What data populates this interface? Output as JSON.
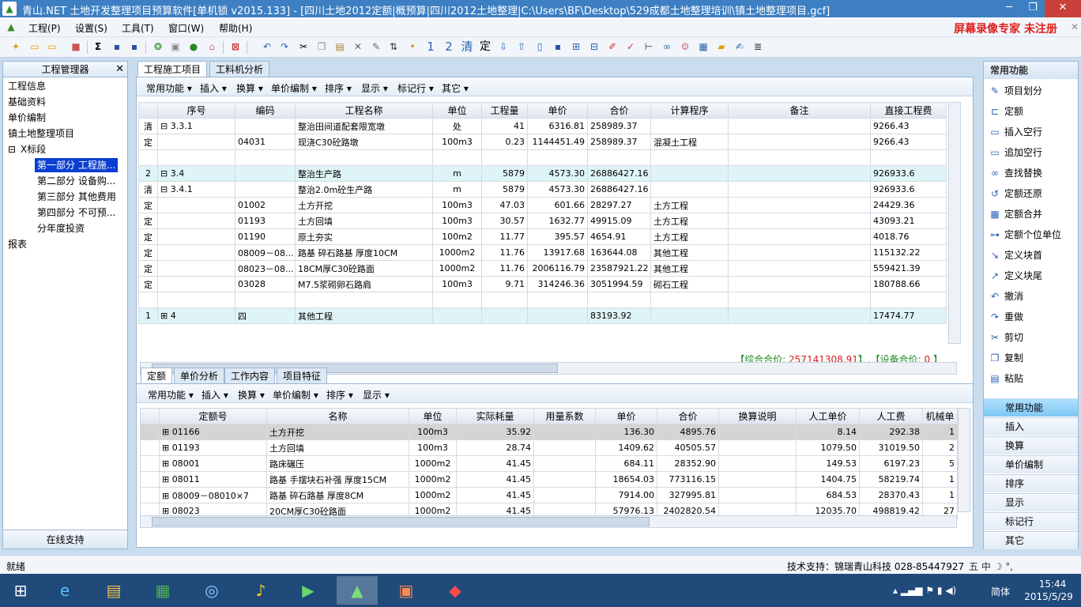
{
  "window": {
    "title": "青山.NET 土地开发整理项目预算软件[单机锁 v2015.133] - [四川土地2012定额|概预算|四川2012土地整理|C:\\Users\\BF\\Desktop\\529成都土地整理培训\\镇土地整理项目.gcf]",
    "min": "─",
    "max": "❐",
    "close": "✕"
  },
  "menu": [
    "工程(P)",
    "设置(S)",
    "工具(T)",
    "窗口(W)",
    "帮助(H)"
  ],
  "watermark": "屏幕录像专家  未注册",
  "toolbar": {
    "num1": "1",
    "num2": "2",
    "clear": "清",
    "fix": "定"
  },
  "left": {
    "title": "工程管理器",
    "close": "✕",
    "tree": [
      "工程信息",
      "基础资料",
      "单价编制",
      "镇土地整理项目",
      "X标段",
      "第一部分 工程施...",
      "第二部分 设备购...",
      "第三部分 其他费用",
      "第四部分 不可预...",
      "分年度投资",
      "报表"
    ],
    "footer": "在线支持"
  },
  "tabs": [
    "工程施工项目",
    "工料机分析"
  ],
  "upper_bar": [
    "常用功能 ▾",
    "插入 ▾",
    "换算 ▾",
    "单价编制 ▾",
    "排序 ▾",
    "显示 ▾",
    "标记行 ▾",
    "其它 ▾"
  ],
  "upper_cols": [
    "序号",
    "编码",
    "工程名称",
    "单位",
    "工程量",
    "单价",
    "合价",
    "计算程序",
    "备注",
    "直接工程费"
  ],
  "upper_rows": [
    [
      "清",
      "⊟ 3.3.1",
      "",
      "整治田间道配套限宽墩",
      "处",
      "41",
      "6316.81",
      "258989.37",
      "",
      "",
      "9266.43"
    ],
    [
      "定",
      "",
      "04031",
      "现浇C30砼路墩",
      "100m3",
      "0.23",
      "1144451.49",
      "258989.37",
      "混凝土工程",
      "",
      "9266.43"
    ],
    [
      "",
      "",
      "",
      "",
      "",
      "",
      "",
      "",
      "",
      "",
      ""
    ],
    [
      "2",
      "⊟ 3.4",
      "",
      "整治生产路",
      "m",
      "5879",
      "4573.30",
      "26886427.16",
      "",
      "",
      "926933.6"
    ],
    [
      "清",
      "⊟ 3.4.1",
      "",
      "整治2.0m砼生产路",
      "m",
      "5879",
      "4573.30",
      "26886427.16",
      "",
      "",
      "926933.6"
    ],
    [
      "定",
      "",
      "01002",
      "土方开挖",
      "100m3",
      "47.03",
      "601.66",
      "28297.27",
      "土方工程",
      "",
      "24429.36"
    ],
    [
      "定",
      "",
      "01193",
      "土方回填",
      "100m3",
      "30.57",
      "1632.77",
      "49915.09",
      "土方工程",
      "",
      "43093.21"
    ],
    [
      "定",
      "",
      "01190",
      "原土夯实",
      "100m2",
      "11.77",
      "395.57",
      "4654.91",
      "土方工程",
      "",
      "4018.76"
    ],
    [
      "定",
      "",
      "08009－08...",
      "路基 碎石路基 厚度10CM",
      "1000m2",
      "11.76",
      "13917.68",
      "163644.08",
      "其他工程",
      "",
      "115132.22"
    ],
    [
      "定",
      "",
      "08023－08...",
      "18CM厚C30砼路面",
      "1000m2",
      "11.76",
      "2006116.79",
      "23587921.22",
      "其他工程",
      "",
      "559421.39"
    ],
    [
      "定",
      "",
      "03028",
      "M7.5浆砌卵石路肩",
      "100m3",
      "9.71",
      "314246.36",
      "3051994.59",
      "砌石工程",
      "",
      "180788.66"
    ],
    [
      "",
      "",
      "",
      "",
      "",
      "",
      "",
      "",
      "",
      "",
      ""
    ],
    [
      "1",
      "⊞ 4",
      "四",
      "其他工程",
      "",
      "",
      "",
      "83193.92",
      "",
      "",
      "17474.77"
    ]
  ],
  "summary": {
    "p1": "【综合合价: ",
    "v1": "257141308.91",
    "p2": "】,【设备合价: ",
    "v2": "0",
    "p3": " 】"
  },
  "lower_tabs": [
    "定额",
    "单价分析",
    "工作内容",
    "项目特征"
  ],
  "lower_bar": [
    "常用功能 ▾",
    "插入 ▾",
    "换算 ▾",
    "单价编制 ▾",
    "排序 ▾",
    "显示 ▾"
  ],
  "lower_cols": [
    "定额号",
    "名称",
    "单位",
    "实际耗量",
    "用量系数",
    "单价",
    "合价",
    "换算说明",
    "人工单价",
    "人工费",
    "机械单"
  ],
  "lower_rows": [
    [
      "⊞ 01166",
      "土方开挖",
      "100m3",
      "35.92",
      "",
      "136.30",
      "4895.76",
      "",
      "8.14",
      "292.38",
      "1"
    ],
    [
      "⊞ 01193",
      "土方回填",
      "100m3",
      "28.74",
      "",
      "1409.62",
      "40505.57",
      "",
      "1079.50",
      "31019.50",
      "2"
    ],
    [
      "⊞ 08001",
      "路床碾压",
      "1000m2",
      "41.45",
      "",
      "684.11",
      "28352.90",
      "",
      "149.53",
      "6197.23",
      "5"
    ],
    [
      "⊞ 08011",
      "路基 手摆块石补强 厚度15CM",
      "1000m2",
      "41.45",
      "",
      "18654.03",
      "773116.15",
      "",
      "1404.75",
      "58219.74",
      "1"
    ],
    [
      "⊞ 08009－08010×7",
      "路基 碎石路基 厚度8CM",
      "1000m2",
      "41.45",
      "",
      "7914.00",
      "327995.81",
      "",
      "684.53",
      "28370.43",
      "1"
    ],
    [
      "⊞ 08023",
      "20CM厚C30砼路面",
      "1000m2",
      "41.45",
      "",
      "57976.13",
      "2402820.54",
      "",
      "12035.70",
      "498819.42",
      "27"
    ]
  ],
  "right": {
    "title": "常用功能",
    "items": [
      "项目划分",
      "定额",
      "插入空行",
      "追加空行",
      "查找替换",
      "定额还原",
      "定额合并",
      "定额个位单位",
      "定义块首",
      "定义块尾",
      "撤消",
      "重做",
      "剪切",
      "复制",
      "粘贴"
    ],
    "tabs": [
      "常用功能",
      "插入",
      "换算",
      "单价编制",
      "排序",
      "显示",
      "标记行",
      "其它"
    ]
  },
  "status": {
    "left": "就绪",
    "support": "技术支持：锦瑞青山科技 028-85447927",
    "ime": "五 中 ☽ °,"
  },
  "clock": {
    "time": "15:44",
    "date": "2015/5/29",
    "lang": "简体"
  }
}
